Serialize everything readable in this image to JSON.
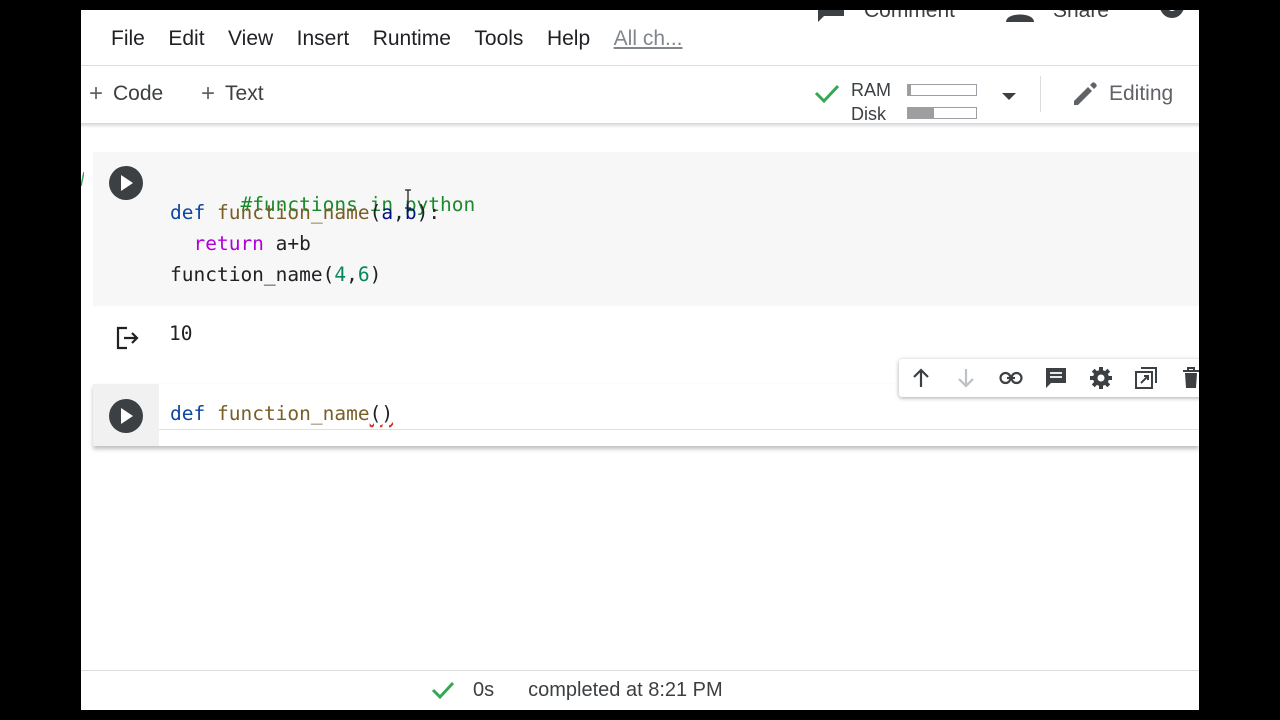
{
  "header": {
    "comment_label": "Comment",
    "share_label": "Share"
  },
  "menu": {
    "items": [
      "File",
      "Edit",
      "View",
      "Insert",
      "Runtime",
      "Tools",
      "Help"
    ],
    "all_changes": "All ch..."
  },
  "toolbar": {
    "add_code": "Code",
    "add_text": "Text",
    "ram_label": "RAM",
    "disk_label": "Disk",
    "ram_fraction": 0.04,
    "disk_fraction": 0.38,
    "mode_label": "Editing"
  },
  "cells": [
    {
      "lines": [
        {
          "comment": "#functions in python"
        },
        {
          "kw": "def",
          "fn": "function_name",
          "open": "(",
          "a": "a",
          "comma": ",",
          "b": "b",
          "close": "):"
        },
        {
          "indent": "  ",
          "ret": "return",
          "expr": " a+b"
        },
        {
          "fn": "function_name",
          "open": "(",
          "n1": "4",
          "comma": ",",
          "n2": "6",
          "close": ")"
        }
      ],
      "output": "10"
    },
    {
      "kw": "def",
      "fn": "function_name",
      "parens": "()"
    }
  ],
  "status": {
    "duration": "0s",
    "completed": "completed at 8:21 PM"
  },
  "colors": {
    "accent_green": "#34a853",
    "keyword": "#0d47a1",
    "comment": "#1b8a2c",
    "function": "#795e26",
    "return": "#af00db",
    "number": "#098658"
  }
}
